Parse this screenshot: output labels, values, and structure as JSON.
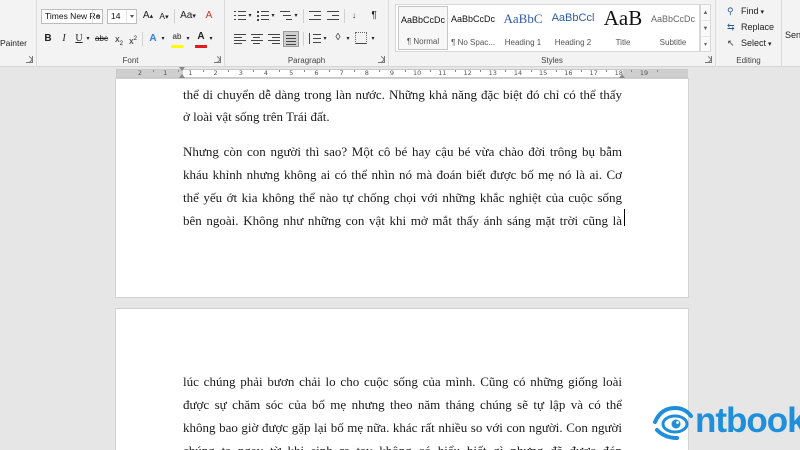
{
  "ribbon": {
    "clipboard": {
      "format_painter_label": "Painter"
    },
    "font": {
      "group_label": "Font",
      "font_name": "Times New Ro",
      "font_size": "14",
      "grow_label": "A",
      "shrink_label": "A",
      "case_label": "Aa",
      "clear_label": "A",
      "bold": "B",
      "italic": "I",
      "underline": "U",
      "strikethrough": "abc",
      "subscript": "x",
      "subscript_mark": "2",
      "superscript": "x",
      "superscript_mark": "2",
      "text_effects": "A",
      "highlight_label": "ab",
      "font_color_label": "A",
      "highlight_color": "#ffff00",
      "font_color": "#e21c1c"
    },
    "paragraph": {
      "group_label": "Paragraph",
      "show_marks": "¶"
    },
    "styles": {
      "group_label": "Styles",
      "items": [
        {
          "sample": "AaBbCcDc",
          "name": "¶ Normal"
        },
        {
          "sample": "AaBbCcDc",
          "name": "¶ No Spac..."
        },
        {
          "sample": "AaBbC",
          "name": "Heading 1"
        },
        {
          "sample": "AaBbCcl",
          "name": "Heading 2"
        },
        {
          "sample": "AaB",
          "name": "Title"
        },
        {
          "sample": "AaBbCcDc",
          "name": "Subtitle"
        }
      ]
    },
    "editing": {
      "group_label": "Editing",
      "find_label": "Find",
      "replace_label": "Replace",
      "select_label": "Select",
      "sensitivity_label": "Sen"
    }
  },
  "ruler": {
    "numbers": [
      "2",
      "1",
      "1",
      "2",
      "3",
      "4",
      "5",
      "6",
      "7",
      "8",
      "9",
      "10",
      "11",
      "12",
      "13",
      "14",
      "15",
      "16",
      "17",
      "18",
      "19"
    ]
  },
  "document": {
    "page1": {
      "para1": [
        "thể di chuyển dễ dàng trong làn nước. Những khả năng đặc biệt đó chỉ có thể thấy",
        "ở loài vật sống trên Trái đất."
      ],
      "para2": [
        "Nhưng còn con người thì sao? Một cô bé hay cậu bé vừa chào đời trông bụ bẫm",
        "kháu khỉnh nhưng không ai có thể nhìn nó mà đoán biết được bố mẹ nó là ai. Cơ",
        "thể yếu ớt kia không thể nào tự chống chọi với những khắc nghiệt của cuộc sống",
        "bên ngoài. Không như những con vật khi mở mắt thấy ánh sáng mặt trời cũng là"
      ]
    },
    "page2": {
      "para1": [
        "lúc chúng phải bươn chải lo cho cuộc sống của mình. Cũng có những giống loài",
        "được sự chăm sóc của bố mẹ nhưng theo năm tháng chúng sẽ tự lập và có thể",
        "không bao giờ được gặp lại bố mẹ nữa. khác rất nhiều so với con người. Con người",
        "chúng ta ngay từ khi sinh ra tay không có hiểu biết gì nhưng đã được đón"
      ]
    }
  },
  "logo": {
    "text": "ntbook",
    "color": "#1f8fdb"
  }
}
